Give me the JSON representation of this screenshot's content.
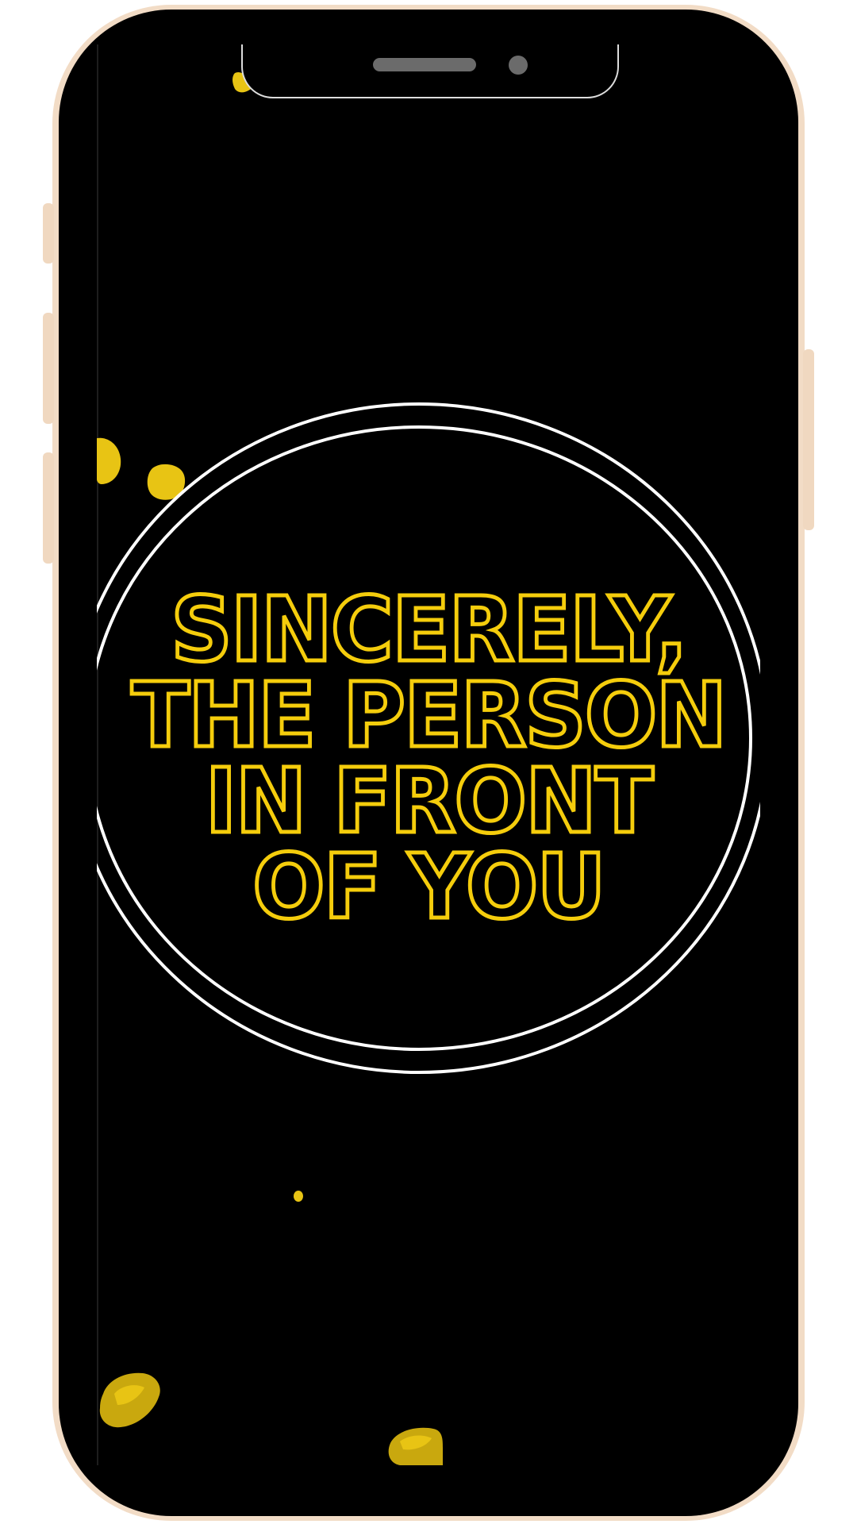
{
  "story": {
    "headline_lines": [
      "SINCERELY,",
      "THE PERSON",
      "IN FRONT",
      "OF YOU"
    ]
  },
  "colors": {
    "background": "#000000",
    "text_outline": "#f5cd0c",
    "ring": "#ffffff",
    "phone_frame": "#f2dcc6",
    "splatter": "#e8c414"
  },
  "icons": {
    "speaker": "speaker-grille-icon",
    "camera": "front-camera-icon"
  }
}
